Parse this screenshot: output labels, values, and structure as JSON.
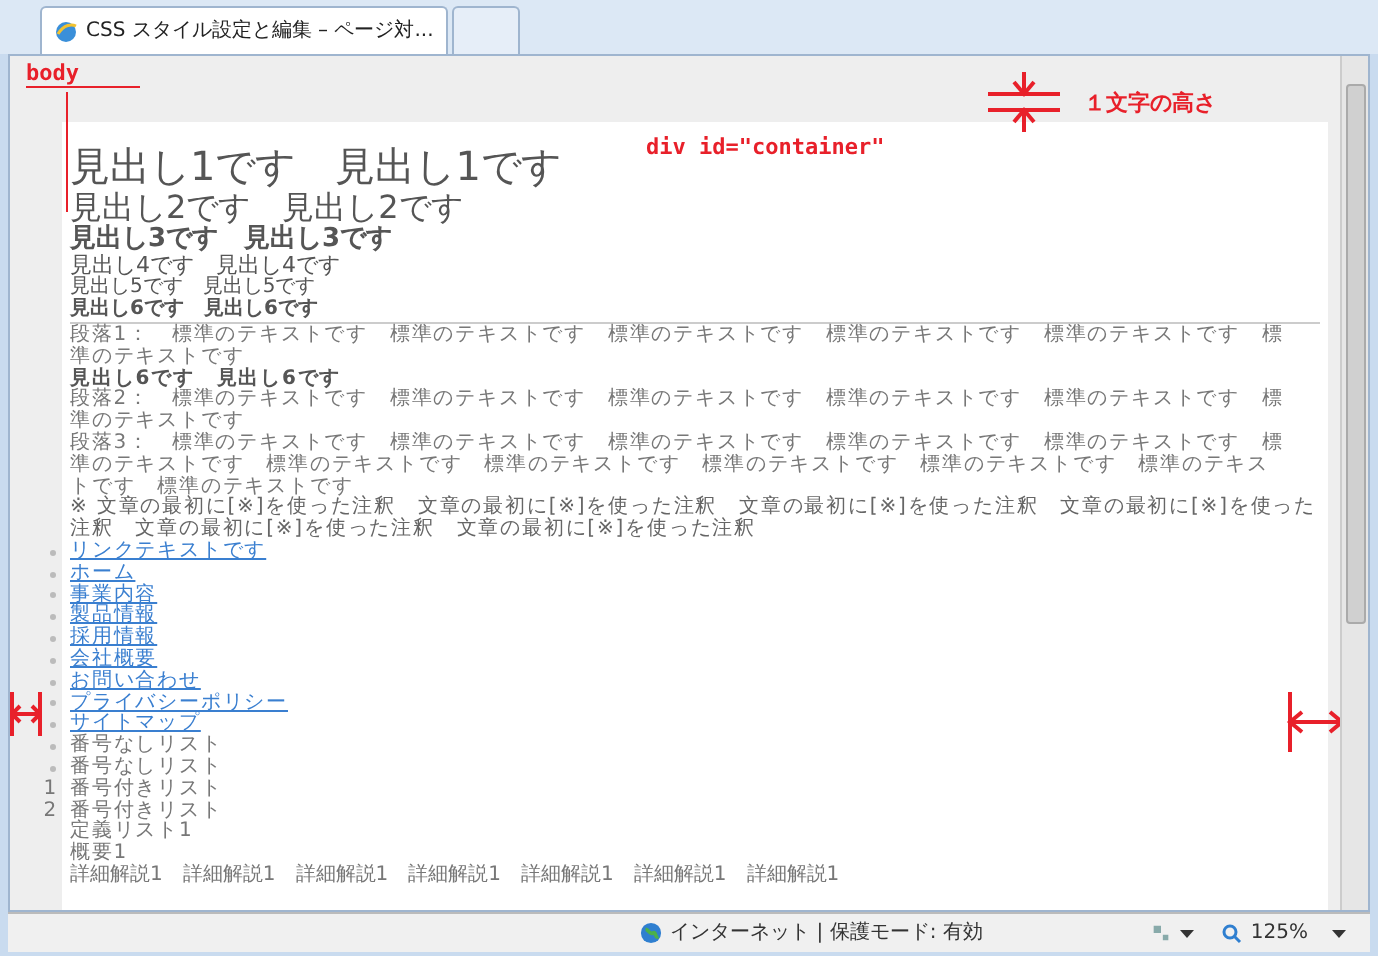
{
  "tabs": [
    {
      "label": "CSS スタイル設定と編集 – ページ対...",
      "selected": true,
      "kind": "page"
    },
    {
      "selected": false,
      "kind": "new"
    }
  ],
  "annotations": {
    "body": "body",
    "container": "div id=\"container\"",
    "char_height": "１文字の高さ"
  },
  "headings": [
    "見出し1です　見出し1です",
    "見出し2です　見出し2です",
    "見出し3です　見出し3です",
    "見出し4です　見出し4です",
    "見出し5です　見出し5です",
    "見出し6です　見出し6です"
  ],
  "blocks": [
    {
      "kind": "paragraph",
      "text": "段落1：　標準のテキストです　標準のテキストです　標準のテキストです　標準のテキストです　標準のテキストです　標準のテキストです"
    },
    {
      "kind": "heading",
      "text": "見出し6です　見出し6です"
    },
    {
      "kind": "paragraph",
      "text": "段落2：　標準のテキストです　標準のテキストです　標準のテキストです　標準のテキストです　標準のテキストです　標準のテキストです"
    },
    {
      "kind": "paragraph",
      "text": "段落3：　標準のテキストです　標準のテキストです　標準のテキストです　標準のテキストです　標準のテキストです　標準のテキストです　標準のテキストです　標準のテキストです　標準のテキストです　標準のテキストです　標準のテキストです　標準のテキストです"
    },
    {
      "kind": "note",
      "text": "※ 文章の最初に[※]を使った注釈　文章の最初に[※]を使った注釈　文章の最初に[※]を使った注釈　文章の最初に[※]を使った注釈　文章の最初に[※]を使った注釈　文章の最初に[※]を使った注釈"
    }
  ],
  "links": [
    "リンクテキストです",
    "ホーム",
    "事業内容",
    "製品情報",
    "採用情報",
    "会社概要",
    "お問い合わせ",
    "プライバシーポリシー",
    "サイトマップ"
  ],
  "unordered": [
    "番号なしリスト",
    "番号なしリスト"
  ],
  "ordered": [
    {
      "number": "1",
      "text": "番号付きリスト"
    },
    {
      "number": "2",
      "text": "番号付きリスト"
    }
  ],
  "definition": {
    "term": "定義リスト1",
    "summary": "概要1",
    "details": [
      "詳細解説1",
      "詳細解説1",
      "詳細解説1",
      "詳細解説1",
      "詳細解説1",
      "詳細解説1",
      "詳細解説1"
    ]
  },
  "status_bar": {
    "zone": "インターネット | 保護モード: 有効",
    "zoom": "125%"
  }
}
